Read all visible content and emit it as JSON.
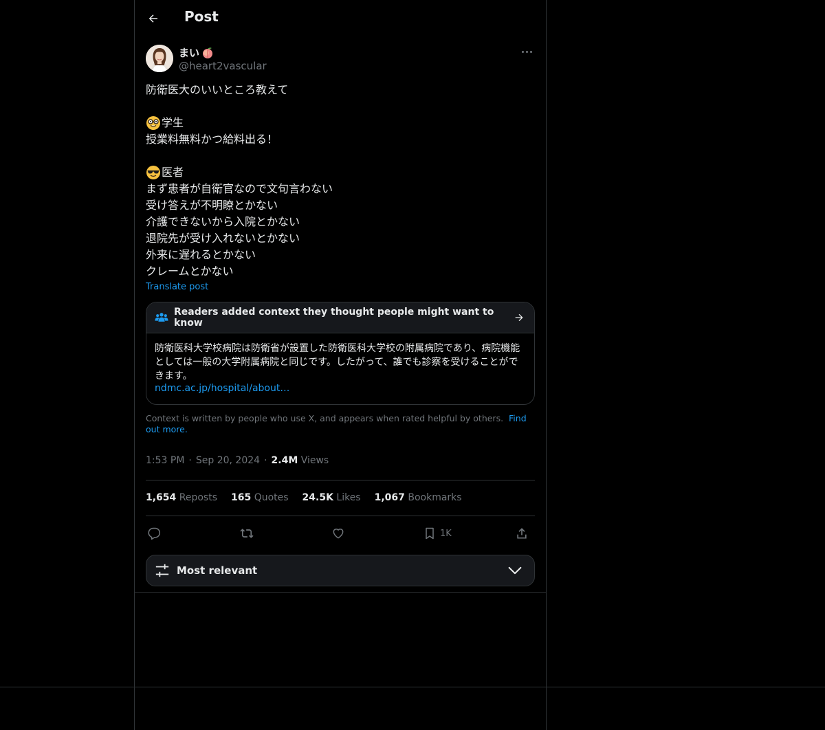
{
  "header": {
    "title": "Post",
    "back_icon": "arrow-left-icon"
  },
  "author": {
    "display_name": "まい",
    "name_emoji": "peach-emoji",
    "handle": "@heart2vascular"
  },
  "post": {
    "lines": [
      "防衛医大のいいところ教えて",
      "",
      "学生",
      "授業料無料かつ給料出る！",
      "",
      "医者",
      "まず患者が自衛官なので文句言わない",
      "受け答えが不明瞭とかない",
      "介護できないから入院とかない",
      "退院先が受け入れないとかない",
      "外来に遅れるとかない",
      "クレームとかない"
    ],
    "student_emoji": "nerd-face-emoji",
    "doctor_emoji": "sunglasses-face-emoji",
    "translate_label": "Translate post"
  },
  "community_note": {
    "heading": "Readers added context they thought people might want to know",
    "body": "防衛医科大学校病院は防衛省が設置した防衛医科大学校の附属病院であり、病院機能としては一般の大学附属病院と同じです。したがって、誰でも診察を受けることができます。",
    "link": "ndmc.ac.jp/hospital/about…",
    "disclaimer": "Context is written by people who use X, and appears when rated helpful by others.",
    "find_out_more": "Find out more."
  },
  "meta": {
    "time": "1:53 PM",
    "date": "Sep 20, 2024",
    "views_count": "2.4M",
    "views_label": "Views",
    "separator": "·"
  },
  "stats": {
    "reposts_count": "1,654",
    "reposts_label": "Reposts",
    "quotes_count": "165",
    "quotes_label": "Quotes",
    "likes_count": "24.5K",
    "likes_label": "Likes",
    "bookmarks_count": "1,067",
    "bookmarks_label": "Bookmarks"
  },
  "actions": {
    "bookmark_count": "1K"
  },
  "sort": {
    "label": "Most relevant"
  },
  "colors": {
    "background": "#000000",
    "text": "#e7e9ea",
    "muted": "#71767b",
    "accent": "#1d9bf0",
    "border": "#2f3336",
    "note_bg": "#16181c"
  }
}
